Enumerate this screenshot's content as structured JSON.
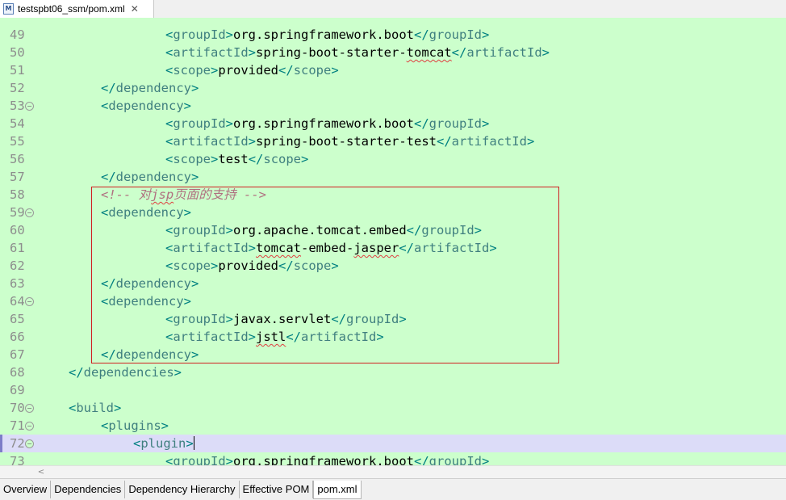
{
  "editor_tab": {
    "icon": "maven-pom-file-icon",
    "title": "testspbt06_ssm/pom.xml",
    "close": "✕"
  },
  "lines": [
    {
      "n": "49",
      "fold": false,
      "indent": 4,
      "tokens": [
        [
          "b",
          "<"
        ],
        [
          "t",
          "groupId"
        ],
        [
          "b",
          ">"
        ],
        [
          "x",
          "org.springframework.boot"
        ],
        [
          "b",
          "</"
        ],
        [
          "t",
          "groupId"
        ],
        [
          "b",
          ">"
        ]
      ]
    },
    {
      "n": "50",
      "fold": false,
      "indent": 4,
      "tokens": [
        [
          "b",
          "<"
        ],
        [
          "t",
          "artifactId"
        ],
        [
          "b",
          ">"
        ],
        [
          "x",
          "spring-boot-starter-"
        ],
        [
          "xs",
          "tomcat"
        ],
        [
          "b",
          "</"
        ],
        [
          "t",
          "artifactId"
        ],
        [
          "b",
          ">"
        ]
      ]
    },
    {
      "n": "51",
      "fold": false,
      "indent": 4,
      "tokens": [
        [
          "b",
          "<"
        ],
        [
          "t",
          "scope"
        ],
        [
          "b",
          ">"
        ],
        [
          "x",
          "provided"
        ],
        [
          "b",
          "</"
        ],
        [
          "t",
          "scope"
        ],
        [
          "b",
          ">"
        ]
      ]
    },
    {
      "n": "52",
      "fold": false,
      "indent": 2,
      "tokens": [
        [
          "b",
          "</"
        ],
        [
          "t",
          "dependency"
        ],
        [
          "b",
          ">"
        ]
      ]
    },
    {
      "n": "53",
      "fold": true,
      "indent": 2,
      "tokens": [
        [
          "b",
          "<"
        ],
        [
          "t",
          "dependency"
        ],
        [
          "b",
          ">"
        ]
      ]
    },
    {
      "n": "54",
      "fold": false,
      "indent": 4,
      "tokens": [
        [
          "b",
          "<"
        ],
        [
          "t",
          "groupId"
        ],
        [
          "b",
          ">"
        ],
        [
          "x",
          "org.springframework.boot"
        ],
        [
          "b",
          "</"
        ],
        [
          "t",
          "groupId"
        ],
        [
          "b",
          ">"
        ]
      ]
    },
    {
      "n": "55",
      "fold": false,
      "indent": 4,
      "tokens": [
        [
          "b",
          "<"
        ],
        [
          "t",
          "artifactId"
        ],
        [
          "b",
          ">"
        ],
        [
          "x",
          "spring-boot-starter-test"
        ],
        [
          "b",
          "</"
        ],
        [
          "t",
          "artifactId"
        ],
        [
          "b",
          ">"
        ]
      ]
    },
    {
      "n": "56",
      "fold": false,
      "indent": 4,
      "tokens": [
        [
          "b",
          "<"
        ],
        [
          "t",
          "scope"
        ],
        [
          "b",
          ">"
        ],
        [
          "x",
          "test"
        ],
        [
          "b",
          "</"
        ],
        [
          "t",
          "scope"
        ],
        [
          "b",
          ">"
        ]
      ]
    },
    {
      "n": "57",
      "fold": false,
      "indent": 2,
      "tokens": [
        [
          "b",
          "</"
        ],
        [
          "t",
          "dependency"
        ],
        [
          "b",
          ">"
        ]
      ]
    },
    {
      "n": "58",
      "fold": false,
      "indent": 2,
      "tokens": [
        [
          "c",
          "<!-- 对"
        ],
        [
          "cs",
          "jsp"
        ],
        [
          "c",
          "页面的支持 -->"
        ]
      ]
    },
    {
      "n": "59",
      "fold": true,
      "indent": 2,
      "tokens": [
        [
          "b",
          "<"
        ],
        [
          "t",
          "dependency"
        ],
        [
          "b",
          ">"
        ]
      ]
    },
    {
      "n": "60",
      "fold": false,
      "indent": 4,
      "tokens": [
        [
          "b",
          "<"
        ],
        [
          "t",
          "groupId"
        ],
        [
          "b",
          ">"
        ],
        [
          "x",
          "org.apache.tomcat.embed"
        ],
        [
          "b",
          "</"
        ],
        [
          "t",
          "groupId"
        ],
        [
          "b",
          ">"
        ]
      ]
    },
    {
      "n": "61",
      "fold": false,
      "indent": 4,
      "tokens": [
        [
          "b",
          "<"
        ],
        [
          "t",
          "artifactId"
        ],
        [
          "b",
          ">"
        ],
        [
          "xs",
          "tomcat"
        ],
        [
          "x",
          "-embed-"
        ],
        [
          "xs",
          "jasper"
        ],
        [
          "b",
          "</"
        ],
        [
          "t",
          "artifactId"
        ],
        [
          "b",
          ">"
        ]
      ]
    },
    {
      "n": "62",
      "fold": false,
      "indent": 4,
      "tokens": [
        [
          "b",
          "<"
        ],
        [
          "t",
          "scope"
        ],
        [
          "b",
          ">"
        ],
        [
          "x",
          "provided"
        ],
        [
          "b",
          "</"
        ],
        [
          "t",
          "scope"
        ],
        [
          "b",
          ">"
        ]
      ]
    },
    {
      "n": "63",
      "fold": false,
      "indent": 2,
      "tokens": [
        [
          "b",
          "</"
        ],
        [
          "t",
          "dependency"
        ],
        [
          "b",
          ">"
        ]
      ]
    },
    {
      "n": "64",
      "fold": true,
      "indent": 2,
      "tokens": [
        [
          "b",
          "<"
        ],
        [
          "t",
          "dependency"
        ],
        [
          "b",
          ">"
        ]
      ]
    },
    {
      "n": "65",
      "fold": false,
      "indent": 4,
      "tokens": [
        [
          "b",
          "<"
        ],
        [
          "t",
          "groupId"
        ],
        [
          "b",
          ">"
        ],
        [
          "x",
          "javax.servlet"
        ],
        [
          "b",
          "</"
        ],
        [
          "t",
          "groupId"
        ],
        [
          "b",
          ">"
        ]
      ]
    },
    {
      "n": "66",
      "fold": false,
      "indent": 4,
      "tokens": [
        [
          "b",
          "<"
        ],
        [
          "t",
          "artifactId"
        ],
        [
          "b",
          ">"
        ],
        [
          "xs",
          "jstl"
        ],
        [
          "b",
          "</"
        ],
        [
          "t",
          "artifactId"
        ],
        [
          "b",
          ">"
        ]
      ]
    },
    {
      "n": "67",
      "fold": false,
      "indent": 2,
      "tokens": [
        [
          "b",
          "</"
        ],
        [
          "t",
          "dependency"
        ],
        [
          "b",
          ">"
        ]
      ]
    },
    {
      "n": "68",
      "fold": false,
      "indent": 1,
      "tokens": [
        [
          "b",
          "</"
        ],
        [
          "t",
          "dependencies"
        ],
        [
          "b",
          ">"
        ]
      ]
    },
    {
      "n": "69",
      "fold": false,
      "indent": 0,
      "tokens": []
    },
    {
      "n": "70",
      "fold": true,
      "indent": 1,
      "tokens": [
        [
          "b",
          "<"
        ],
        [
          "t",
          "build"
        ],
        [
          "b",
          ">"
        ]
      ]
    },
    {
      "n": "71",
      "fold": true,
      "indent": 2,
      "tokens": [
        [
          "b",
          "<"
        ],
        [
          "t",
          "plugins"
        ],
        [
          "b",
          ">"
        ]
      ]
    },
    {
      "n": "72",
      "fold": true,
      "indent": 3,
      "current": true,
      "tokens": [
        [
          "b",
          "<"
        ],
        [
          "t",
          "plugin"
        ],
        [
          "b",
          ">"
        ]
      ]
    },
    {
      "n": "73",
      "fold": false,
      "indent": 4,
      "tokens": [
        [
          "b",
          "<"
        ],
        [
          "t",
          "groupId"
        ],
        [
          "b",
          ">"
        ],
        [
          "x",
          "org.springframework.boot"
        ],
        [
          "b",
          "</"
        ],
        [
          "t",
          "groupId"
        ],
        [
          "b",
          ">"
        ]
      ]
    }
  ],
  "scrollbar": {
    "left_arrow": "<"
  },
  "bottom_tabs": [
    {
      "label": "Overview",
      "active": false
    },
    {
      "label": "Dependencies",
      "active": false
    },
    {
      "label": "Dependency Hierarchy",
      "active": false
    },
    {
      "label": "Effective POM",
      "active": false
    },
    {
      "label": "pom.xml",
      "active": true
    }
  ]
}
